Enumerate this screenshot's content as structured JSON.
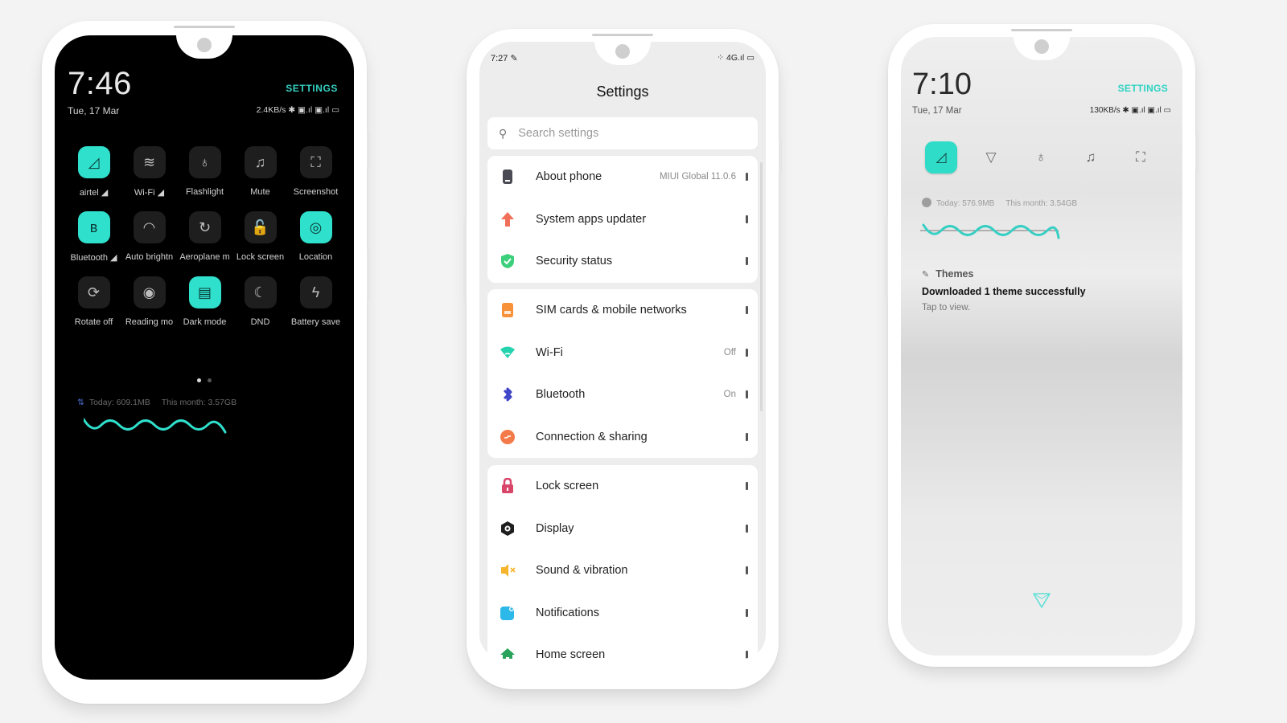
{
  "phone1": {
    "time": "7:46",
    "date": "Tue, 17 Mar",
    "settings_link": "SETTINGS",
    "status": "2.4KB/s ✱ ▣.ıl ▣.ıl ▭",
    "tiles": [
      {
        "label": "airtel ◢",
        "icon": "mobile-data-icon",
        "glyph": "◿",
        "on": true
      },
      {
        "label": "Wi-Fi ◢",
        "icon": "wifi-icon",
        "glyph": "≋",
        "on": false
      },
      {
        "label": "Flashlight",
        "icon": "flashlight-icon",
        "glyph": "♁",
        "on": false
      },
      {
        "label": "Mute",
        "icon": "bell-icon",
        "glyph": "♫",
        "on": false
      },
      {
        "label": "Screenshot",
        "icon": "screenshot-icon",
        "glyph": "⛶",
        "on": false
      },
      {
        "label": "Bluetooth ◢",
        "icon": "bluetooth-icon",
        "glyph": "ʙ",
        "on": true
      },
      {
        "label": "Auto brightn",
        "icon": "auto-brightness-icon",
        "glyph": "◠",
        "on": false
      },
      {
        "label": "Aeroplane m",
        "icon": "aeroplane-icon",
        "glyph": "↻",
        "on": false
      },
      {
        "label": "Lock screen",
        "icon": "lock-icon",
        "glyph": "🔓",
        "on": false
      },
      {
        "label": "Location",
        "icon": "location-icon",
        "glyph": "◎",
        "on": true
      },
      {
        "label": "Rotate off",
        "icon": "rotate-icon",
        "glyph": "⟳",
        "on": false
      },
      {
        "label": "Reading mo",
        "icon": "eye-icon",
        "glyph": "◉",
        "on": false
      },
      {
        "label": "Dark mode",
        "icon": "dark-mode-icon",
        "glyph": "▤",
        "on": true
      },
      {
        "label": "DND",
        "icon": "moon-icon",
        "glyph": "☾",
        "on": false
      },
      {
        "label": "Battery save",
        "icon": "battery-saver-icon",
        "glyph": "ϟ",
        "on": false
      }
    ],
    "data_today": "Today: 609.1MB",
    "data_month": "This month: 3.57GB",
    "page_count": 2,
    "page_active": 1,
    "accent": "#2fe0cc"
  },
  "phone2": {
    "status_time": "7:27 ✎",
    "status_right": "⁘ 4G.ıl ▭",
    "title": "Settings",
    "search_placeholder": "Search settings",
    "groups": [
      [
        {
          "label": "About phone",
          "value": "MIUI Global 11.0.6",
          "icon": "phone-icon",
          "color": "#4a4a55"
        },
        {
          "label": "System apps updater",
          "value": "",
          "icon": "arrow-up-icon",
          "color": "#f0705a"
        },
        {
          "label": "Security status",
          "value": "",
          "icon": "shield-check-icon",
          "color": "#3ccf7c"
        }
      ],
      [
        {
          "label": "SIM cards & mobile networks",
          "value": "",
          "icon": "sim-icon",
          "color": "#f7913a"
        },
        {
          "label": "Wi-Fi",
          "value": "Off",
          "icon": "wifi-icon",
          "color": "#25d3b0"
        },
        {
          "label": "Bluetooth",
          "value": "On",
          "icon": "bluetooth-icon",
          "color": "#3e44c8"
        },
        {
          "label": "Connection & sharing",
          "value": "",
          "icon": "connection-icon",
          "color": "#f47a4a"
        }
      ],
      [
        {
          "label": "Lock screen",
          "value": "",
          "icon": "lock-icon",
          "color": "#d8466a"
        },
        {
          "label": "Display",
          "value": "",
          "icon": "display-icon",
          "color": "#1e1e1e"
        },
        {
          "label": "Sound & vibration",
          "value": "",
          "icon": "speaker-icon",
          "color": "#f5b42a"
        },
        {
          "label": "Notifications",
          "value": "",
          "icon": "notification-icon",
          "color": "#2db8ea"
        },
        {
          "label": "Home screen",
          "value": "",
          "icon": "home-icon",
          "color": "#2aa35a"
        }
      ]
    ]
  },
  "phone3": {
    "time": "7:10",
    "date": "Tue, 17 Mar",
    "settings_link": "SETTINGS",
    "status": "130KB/s ✱ ▣.ıl ▣.ıl ▭",
    "tiles": [
      {
        "icon": "mobile-data-icon",
        "glyph": "◿",
        "on": true
      },
      {
        "icon": "wifi-icon",
        "glyph": "▽",
        "on": false
      },
      {
        "icon": "flashlight-icon",
        "glyph": "♁",
        "on": false
      },
      {
        "icon": "bell-icon",
        "glyph": "♫",
        "on": false
      },
      {
        "icon": "screenshot-icon",
        "glyph": "⛶",
        "on": false
      }
    ],
    "data_today": "Today: 576.9MB",
    "data_month": "This month: 3.54GB",
    "notification": {
      "app": "Themes",
      "title": "Downloaded 1 theme successfully",
      "body": "Tap to view."
    },
    "accent": "#2fdcc8"
  }
}
